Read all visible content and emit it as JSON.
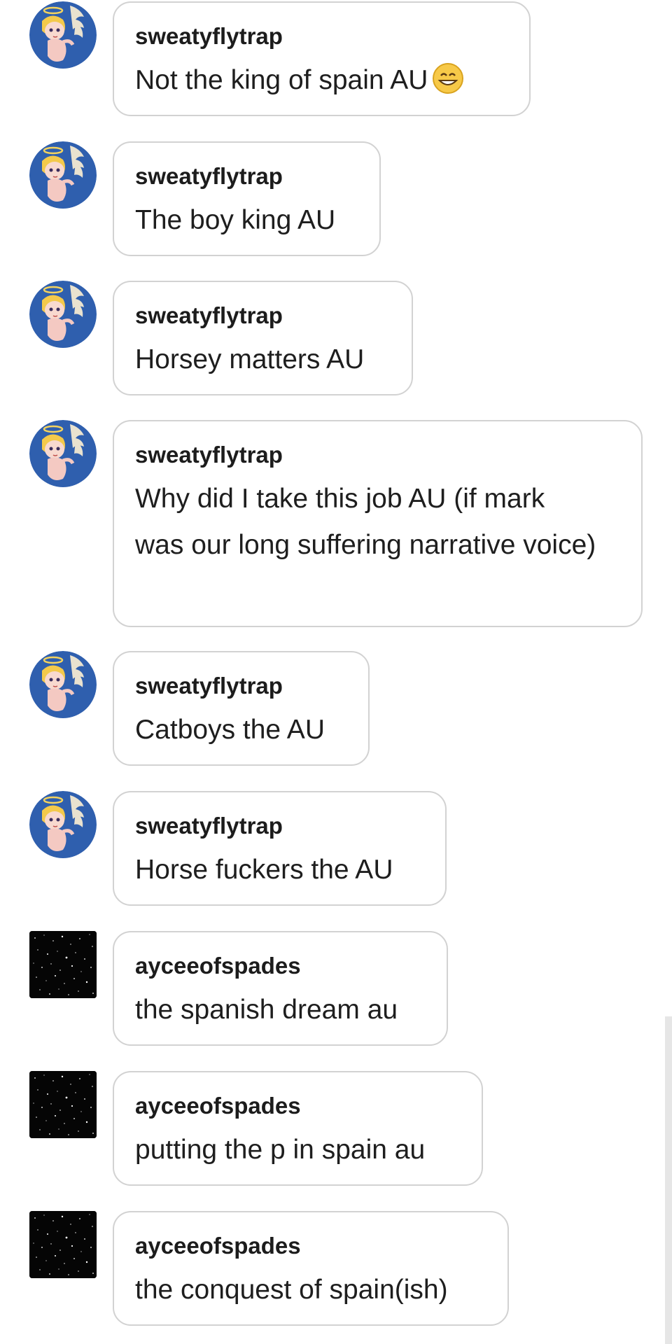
{
  "messages": [
    {
      "user": "sweatyflytrap",
      "text": "Not the king of spain AU",
      "avatar": "angel-avatar",
      "emoji": "grinning-face-emoji"
    },
    {
      "user": "sweatyflytrap",
      "text": "The boy king AU",
      "avatar": "angel-avatar"
    },
    {
      "user": "sweatyflytrap",
      "text": "Horsey matters AU",
      "avatar": "angel-avatar"
    },
    {
      "user": "sweatyflytrap",
      "text": "Why did I take this job AU (if mark was our long suffering narrative voice)",
      "avatar": "angel-avatar"
    },
    {
      "user": "sweatyflytrap",
      "text": "Catboys the AU",
      "avatar": "angel-avatar"
    },
    {
      "user": "sweatyflytrap",
      "text": "Horse fuckers the AU",
      "avatar": "angel-avatar"
    },
    {
      "user": "ayceeofspades",
      "text": "the spanish dream au",
      "avatar": "starfield-avatar"
    },
    {
      "user": "ayceeofspades",
      "text": "putting the p in spain au",
      "avatar": "starfield-avatar"
    },
    {
      "user": "ayceeofspades",
      "text": "the conquest of spain(ish)",
      "avatar": "starfield-avatar"
    }
  ],
  "colors": {
    "bubble_border": "#d2d2d2",
    "avatar_blue": "#2f5fae",
    "avatar_starfield": "#050505"
  }
}
